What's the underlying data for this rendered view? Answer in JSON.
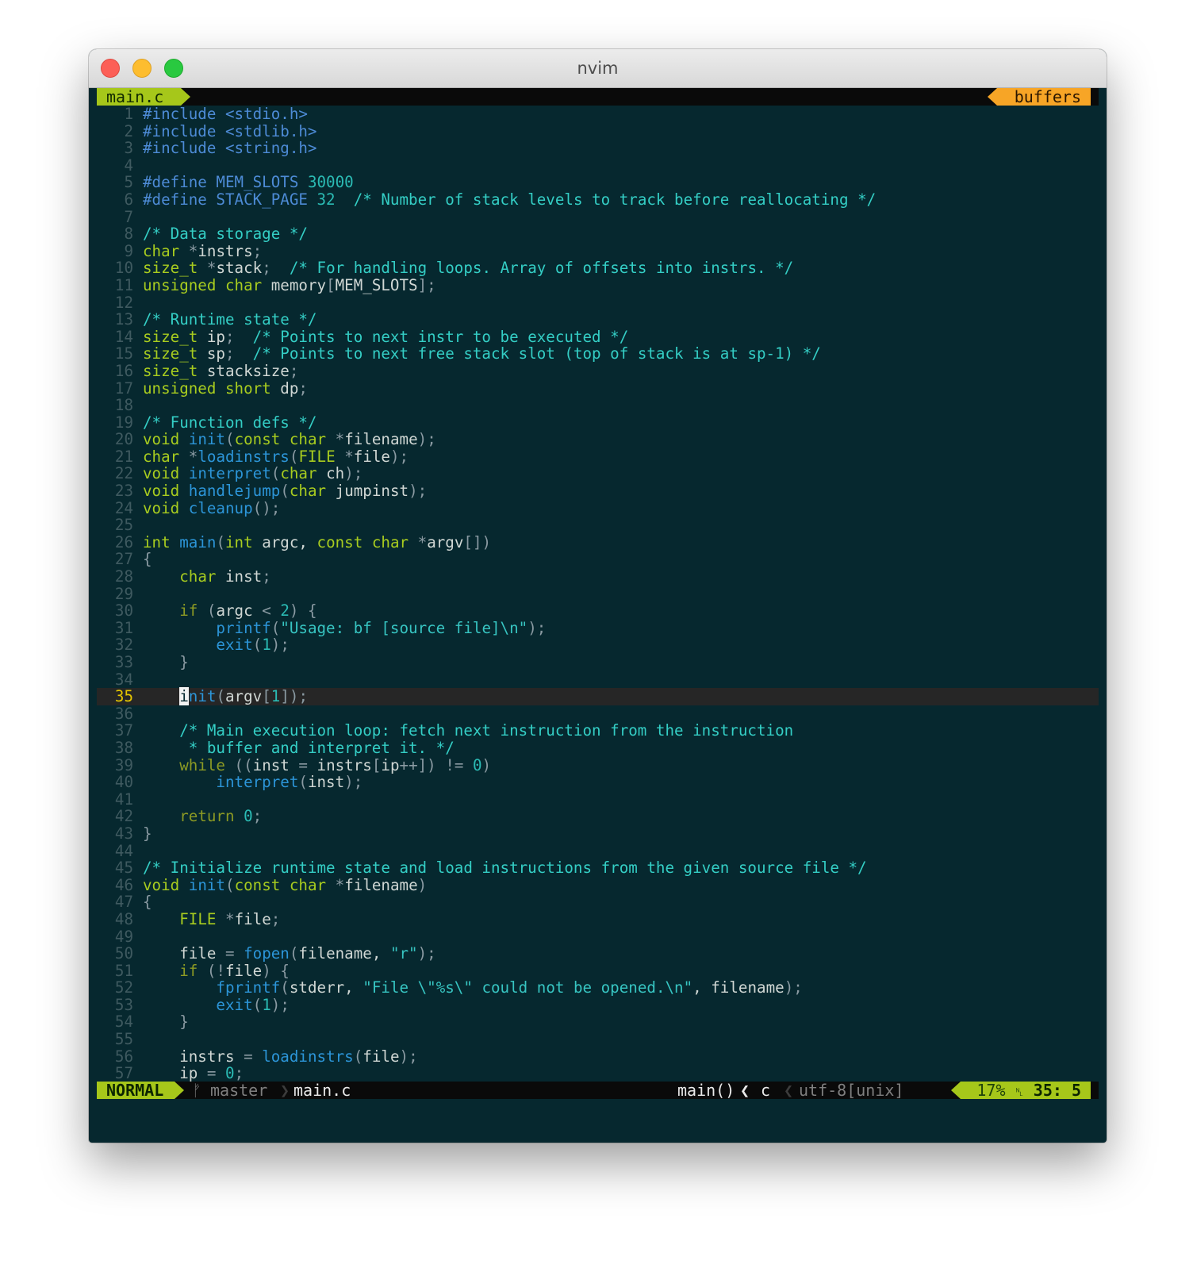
{
  "window": {
    "title": "nvim"
  },
  "tabline": {
    "active_tab": "main.c",
    "right_label": "buffers"
  },
  "editor": {
    "cursor_line": 35,
    "lines": [
      {
        "n": "1",
        "t": [
          [
            "pp",
            "#include <stdio.h>"
          ]
        ]
      },
      {
        "n": "2",
        "t": [
          [
            "pp",
            "#include <stdlib.h>"
          ]
        ]
      },
      {
        "n": "3",
        "t": [
          [
            "pp",
            "#include <string.h>"
          ]
        ]
      },
      {
        "n": "4",
        "t": []
      },
      {
        "n": "5",
        "t": [
          [
            "pp",
            "#define MEM_SLOTS "
          ],
          [
            "nu",
            "30000"
          ]
        ]
      },
      {
        "n": "6",
        "t": [
          [
            "pp",
            "#define STACK_PAGE "
          ],
          [
            "nu",
            "32"
          ],
          [
            "",
            "  "
          ],
          [
            "cm",
            "/* Number of stack levels to track before reallocating */"
          ]
        ]
      },
      {
        "n": "7",
        "t": []
      },
      {
        "n": "8",
        "t": [
          [
            "cm",
            "/* Data storage */"
          ]
        ]
      },
      {
        "n": "9",
        "t": [
          [
            "ty",
            "char"
          ],
          [
            "",
            " "
          ],
          [
            "op",
            "*"
          ],
          [
            "",
            "instrs"
          ],
          [
            "op",
            ";"
          ]
        ]
      },
      {
        "n": "10",
        "t": [
          [
            "ty",
            "size_t"
          ],
          [
            "",
            " "
          ],
          [
            "op",
            "*"
          ],
          [
            "",
            "stack"
          ],
          [
            "op",
            ";"
          ],
          [
            "",
            "  "
          ],
          [
            "cm",
            "/* For handling loops. Array of offsets into instrs. */"
          ]
        ]
      },
      {
        "n": "11",
        "t": [
          [
            "ty",
            "unsigned char"
          ],
          [
            "",
            " memory"
          ],
          [
            "op",
            "["
          ],
          [
            "",
            "MEM_SLOTS"
          ],
          [
            "op",
            "];"
          ]
        ]
      },
      {
        "n": "12",
        "t": []
      },
      {
        "n": "13",
        "t": [
          [
            "cm",
            "/* Runtime state */"
          ]
        ]
      },
      {
        "n": "14",
        "t": [
          [
            "ty",
            "size_t"
          ],
          [
            "",
            " ip"
          ],
          [
            "op",
            ";"
          ],
          [
            "",
            "  "
          ],
          [
            "cm",
            "/* Points to next instr to be executed */"
          ]
        ]
      },
      {
        "n": "15",
        "t": [
          [
            "ty",
            "size_t"
          ],
          [
            "",
            " sp"
          ],
          [
            "op",
            ";"
          ],
          [
            "",
            "  "
          ],
          [
            "cm",
            "/* Points to next free stack slot (top of stack is at sp-1) */"
          ]
        ]
      },
      {
        "n": "16",
        "t": [
          [
            "ty",
            "size_t"
          ],
          [
            "",
            " stacksize"
          ],
          [
            "op",
            ";"
          ]
        ]
      },
      {
        "n": "17",
        "t": [
          [
            "ty",
            "unsigned short"
          ],
          [
            "",
            " dp"
          ],
          [
            "op",
            ";"
          ]
        ]
      },
      {
        "n": "18",
        "t": []
      },
      {
        "n": "19",
        "t": [
          [
            "cm",
            "/* Function defs */"
          ]
        ]
      },
      {
        "n": "20",
        "t": [
          [
            "ty",
            "void"
          ],
          [
            "",
            " "
          ],
          [
            "fn",
            "init"
          ],
          [
            "op",
            "("
          ],
          [
            "ty",
            "const char"
          ],
          [
            "",
            " "
          ],
          [
            "op",
            "*"
          ],
          [
            "",
            "filename"
          ],
          [
            "op",
            ");"
          ]
        ]
      },
      {
        "n": "21",
        "t": [
          [
            "ty",
            "char"
          ],
          [
            "",
            " "
          ],
          [
            "op",
            "*"
          ],
          [
            "fn",
            "loadinstrs"
          ],
          [
            "op",
            "("
          ],
          [
            "ty",
            "FILE"
          ],
          [
            "",
            " "
          ],
          [
            "op",
            "*"
          ],
          [
            "",
            "file"
          ],
          [
            "op",
            ");"
          ]
        ]
      },
      {
        "n": "22",
        "t": [
          [
            "ty",
            "void"
          ],
          [
            "",
            " "
          ],
          [
            "fn",
            "interpret"
          ],
          [
            "op",
            "("
          ],
          [
            "ty",
            "char"
          ],
          [
            "",
            " ch"
          ],
          [
            "op",
            ");"
          ]
        ]
      },
      {
        "n": "23",
        "t": [
          [
            "ty",
            "void"
          ],
          [
            "",
            " "
          ],
          [
            "fn",
            "handlejump"
          ],
          [
            "op",
            "("
          ],
          [
            "ty",
            "char"
          ],
          [
            "",
            " jumpinst"
          ],
          [
            "op",
            ");"
          ]
        ]
      },
      {
        "n": "24",
        "t": [
          [
            "ty",
            "void"
          ],
          [
            "",
            " "
          ],
          [
            "fn",
            "cleanup"
          ],
          [
            "op",
            "();"
          ]
        ]
      },
      {
        "n": "25",
        "t": []
      },
      {
        "n": "26",
        "t": [
          [
            "ty",
            "int"
          ],
          [
            "",
            " "
          ],
          [
            "fn",
            "main"
          ],
          [
            "op",
            "("
          ],
          [
            "ty",
            "int"
          ],
          [
            "",
            " argc, "
          ],
          [
            "ty",
            "const char"
          ],
          [
            "",
            " "
          ],
          [
            "op",
            "*"
          ],
          [
            "",
            "argv"
          ],
          [
            "op",
            "[])"
          ]
        ]
      },
      {
        "n": "27",
        "t": [
          [
            "op",
            "{"
          ]
        ]
      },
      {
        "n": "28",
        "t": [
          [
            "",
            "    "
          ],
          [
            "ty",
            "char"
          ],
          [
            "",
            " inst"
          ],
          [
            "op",
            ";"
          ]
        ]
      },
      {
        "n": "29",
        "t": []
      },
      {
        "n": "30",
        "t": [
          [
            "",
            "    "
          ],
          [
            "kw",
            "if"
          ],
          [
            "",
            " "
          ],
          [
            "op",
            "("
          ],
          [
            "",
            "argc "
          ],
          [
            "op",
            "<"
          ],
          [
            "",
            " "
          ],
          [
            "nu",
            "2"
          ],
          [
            "op",
            ") {"
          ]
        ]
      },
      {
        "n": "31",
        "t": [
          [
            "",
            "        "
          ],
          [
            "fn",
            "printf"
          ],
          [
            "op",
            "("
          ],
          [
            "st",
            "\"Usage: bf [source file]\\n\""
          ],
          [
            "op",
            ");"
          ]
        ]
      },
      {
        "n": "32",
        "t": [
          [
            "",
            "        "
          ],
          [
            "fn",
            "exit"
          ],
          [
            "op",
            "("
          ],
          [
            "nu",
            "1"
          ],
          [
            "op",
            ");"
          ]
        ]
      },
      {
        "n": "33",
        "t": [
          [
            "",
            "    "
          ],
          [
            "op",
            "}"
          ]
        ]
      },
      {
        "n": "34",
        "t": []
      },
      {
        "n": "35",
        "t": [
          [
            "",
            "    "
          ],
          [
            "cur",
            "i"
          ],
          [
            "fn",
            "nit"
          ],
          [
            "op",
            "("
          ],
          [
            "",
            "argv"
          ],
          [
            "op",
            "["
          ],
          [
            "nu",
            "1"
          ],
          [
            "op",
            "]);"
          ]
        ]
      },
      {
        "n": "36",
        "t": []
      },
      {
        "n": "37",
        "t": [
          [
            "",
            "    "
          ],
          [
            "cm",
            "/* Main execution loop: fetch next instruction from the instruction"
          ]
        ]
      },
      {
        "n": "38",
        "t": [
          [
            "",
            "     "
          ],
          [
            "cm",
            "* buffer and interpret it. */"
          ]
        ]
      },
      {
        "n": "39",
        "t": [
          [
            "",
            "    "
          ],
          [
            "kw",
            "while"
          ],
          [
            "",
            " "
          ],
          [
            "op",
            "(("
          ],
          [
            "",
            "inst "
          ],
          [
            "op",
            "="
          ],
          [
            "",
            " instrs"
          ],
          [
            "op",
            "["
          ],
          [
            "",
            "ip"
          ],
          [
            "op",
            "++])"
          ],
          [
            "",
            " "
          ],
          [
            "op",
            "!="
          ],
          [
            "",
            " "
          ],
          [
            "nu",
            "0"
          ],
          [
            "op",
            ")"
          ]
        ]
      },
      {
        "n": "40",
        "t": [
          [
            "",
            "        "
          ],
          [
            "fn",
            "interpret"
          ],
          [
            "op",
            "("
          ],
          [
            "",
            "inst"
          ],
          [
            "op",
            ");"
          ]
        ]
      },
      {
        "n": "41",
        "t": []
      },
      {
        "n": "42",
        "t": [
          [
            "",
            "    "
          ],
          [
            "kw",
            "return"
          ],
          [
            "",
            " "
          ],
          [
            "nu",
            "0"
          ],
          [
            "op",
            ";"
          ]
        ]
      },
      {
        "n": "43",
        "t": [
          [
            "op",
            "}"
          ]
        ]
      },
      {
        "n": "44",
        "t": []
      },
      {
        "n": "45",
        "t": [
          [
            "cm",
            "/* Initialize runtime state and load instructions from the given source file */"
          ]
        ]
      },
      {
        "n": "46",
        "t": [
          [
            "ty",
            "void"
          ],
          [
            "",
            " "
          ],
          [
            "fn",
            "init"
          ],
          [
            "op",
            "("
          ],
          [
            "ty",
            "const char"
          ],
          [
            "",
            " "
          ],
          [
            "op",
            "*"
          ],
          [
            "",
            "filename"
          ],
          [
            "op",
            ")"
          ]
        ]
      },
      {
        "n": "47",
        "t": [
          [
            "op",
            "{"
          ]
        ]
      },
      {
        "n": "48",
        "t": [
          [
            "",
            "    "
          ],
          [
            "ty",
            "FILE"
          ],
          [
            "",
            " "
          ],
          [
            "op",
            "*"
          ],
          [
            "",
            "file"
          ],
          [
            "op",
            ";"
          ]
        ]
      },
      {
        "n": "49",
        "t": []
      },
      {
        "n": "50",
        "t": [
          [
            "",
            "    file "
          ],
          [
            "op",
            "="
          ],
          [
            "",
            " "
          ],
          [
            "fn",
            "fopen"
          ],
          [
            "op",
            "("
          ],
          [
            "",
            "filename, "
          ],
          [
            "st",
            "\"r\""
          ],
          [
            "op",
            ");"
          ]
        ]
      },
      {
        "n": "51",
        "t": [
          [
            "",
            "    "
          ],
          [
            "kw",
            "if"
          ],
          [
            "",
            " "
          ],
          [
            "op",
            "(!"
          ],
          [
            "",
            "file"
          ],
          [
            "op",
            ") {"
          ]
        ]
      },
      {
        "n": "52",
        "t": [
          [
            "",
            "        "
          ],
          [
            "fn",
            "fprintf"
          ],
          [
            "op",
            "("
          ],
          [
            "",
            "stderr, "
          ],
          [
            "st",
            "\"File \\\"%s\\\" could not be opened.\\n\""
          ],
          [
            "",
            ", filename"
          ],
          [
            "op",
            ");"
          ]
        ]
      },
      {
        "n": "53",
        "t": [
          [
            "",
            "        "
          ],
          [
            "fn",
            "exit"
          ],
          [
            "op",
            "("
          ],
          [
            "nu",
            "1"
          ],
          [
            "op",
            ");"
          ]
        ]
      },
      {
        "n": "54",
        "t": [
          [
            "",
            "    "
          ],
          [
            "op",
            "}"
          ]
        ]
      },
      {
        "n": "55",
        "t": []
      },
      {
        "n": "56",
        "t": [
          [
            "",
            "    instrs "
          ],
          [
            "op",
            "="
          ],
          [
            "",
            " "
          ],
          [
            "fn",
            "loadinstrs"
          ],
          [
            "op",
            "("
          ],
          [
            "",
            "file"
          ],
          [
            "op",
            ");"
          ]
        ]
      },
      {
        "n": "57",
        "t": [
          [
            "",
            "    ip "
          ],
          [
            "op",
            "="
          ],
          [
            "",
            " "
          ],
          [
            "nu",
            "0"
          ],
          [
            "op",
            ";"
          ]
        ]
      }
    ]
  },
  "statusline": {
    "mode": "NORMAL",
    "branch_icon": "ᚠ",
    "branch": "master",
    "sep": "❯",
    "file": "main.c",
    "function": "main()",
    "angle": "❮",
    "filetype": "c",
    "angle2": "❮",
    "encoding": "utf-8[unix]",
    "percent": "17%",
    "ln_icon": "␤",
    "line": "35:",
    "col": "5"
  },
  "colors": {
    "background": "#06282f",
    "accent_green": "#a6c71a",
    "accent_orange": "#f7a526",
    "comment": "#34cec5",
    "type": "#a8cc1f",
    "function": "#2c95d8",
    "preproc": "#4d8bd6"
  }
}
